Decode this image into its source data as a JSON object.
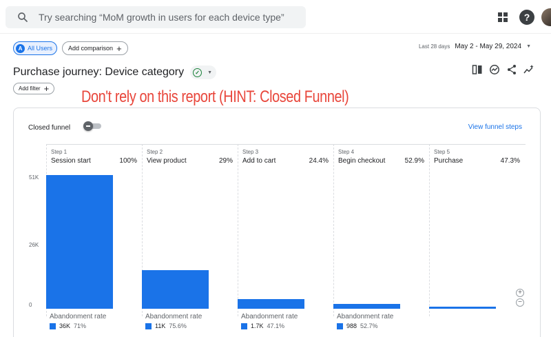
{
  "search": {
    "placeholder": "Try searching “MoM growth in users for each device type”"
  },
  "icons": {
    "search": "search-icon",
    "apps": "apps-grid-icon",
    "help": "help-icon",
    "avatar": "avatar"
  },
  "segments": {
    "all_users": "All Users",
    "all_users_badge": "A",
    "add_comparison": "Add comparison"
  },
  "date_range": {
    "label": "Last 28 days",
    "value": "May 2 - May 29, 2024"
  },
  "report": {
    "title": "Purchase journey: Device category",
    "add_filter": "Add filter"
  },
  "annotation": "Don't rely on this report (HINT: Closed Funnel)",
  "funnel": {
    "closed_funnel_label": "Closed funnel",
    "closed_funnel_on": false,
    "view_steps_link": "View funnel steps",
    "abandonment_label": "Abandonment rate"
  },
  "colors": {
    "accent": "#1a73e8",
    "annotation": "#e8463b"
  },
  "chart_data": {
    "type": "bar",
    "ylim": [
      0,
      51000
    ],
    "yticks": [
      "51K",
      "26K",
      "0"
    ],
    "steps": [
      {
        "step": "Step 1",
        "name": "Session start",
        "pct": "100%",
        "value": 51000,
        "abandon_count": "36K",
        "abandon_rate": "71%"
      },
      {
        "step": "Step 2",
        "name": "View product",
        "pct": "29%",
        "value": 14800,
        "abandon_count": "11K",
        "abandon_rate": "75.6%"
      },
      {
        "step": "Step 3",
        "name": "Add to cart",
        "pct": "24.4%",
        "value": 3600,
        "abandon_count": "1.7K",
        "abandon_rate": "47.1%"
      },
      {
        "step": "Step 4",
        "name": "Begin checkout",
        "pct": "52.9%",
        "value": 1900,
        "abandon_count": "988",
        "abandon_rate": "52.7%"
      },
      {
        "step": "Step 5",
        "name": "Purchase",
        "pct": "47.3%",
        "value": 900
      }
    ]
  }
}
